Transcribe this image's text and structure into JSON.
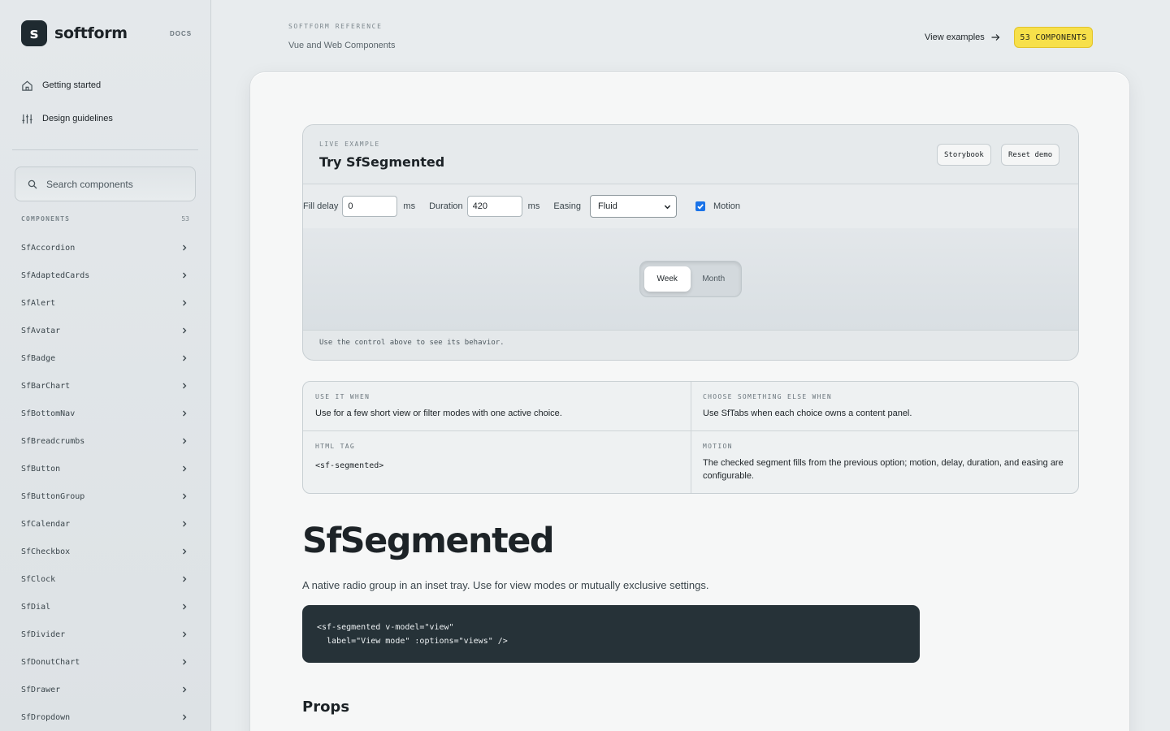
{
  "brand": {
    "name": "softform",
    "logo_letter": "s",
    "docs_label": "DOCS"
  },
  "nav": {
    "getting_started": "Getting started",
    "design_guidelines": "Design guidelines"
  },
  "search": {
    "placeholder": "Search components"
  },
  "components": {
    "heading": "COMPONENTS",
    "count": "53",
    "items": [
      "SfAccordion",
      "SfAdaptedCards",
      "SfAlert",
      "SfAvatar",
      "SfBadge",
      "SfBarChart",
      "SfBottomNav",
      "SfBreadcrumbs",
      "SfButton",
      "SfButtonGroup",
      "SfCalendar",
      "SfCheckbox",
      "SfClock",
      "SfDial",
      "SfDivider",
      "SfDonutChart",
      "SfDrawer",
      "SfDropdown"
    ]
  },
  "header": {
    "kicker": "SOFTFORM REFERENCE",
    "subtitle": "Vue and Web Components",
    "view_examples": "View examples",
    "badge": "53 COMPONENTS"
  },
  "live": {
    "kicker": "LIVE EXAMPLE",
    "title": "Try SfSegmented",
    "storybook": "Storybook",
    "reset": "Reset demo",
    "fill_delay_label": "Fill delay",
    "fill_delay_value": "0",
    "duration_label": "Duration",
    "duration_value": "420",
    "unit": "ms",
    "easing_label": "Easing",
    "easing_value": "Fluid",
    "motion_label": "Motion",
    "motion_checked": true,
    "segments": [
      "Week",
      "Month"
    ],
    "footer": "Use the control above to see its behavior."
  },
  "info": {
    "use_when_k": "USE IT WHEN",
    "use_when_v": "Use for a few short view or filter modes with one active choice.",
    "else_k": "CHOOSE SOMETHING ELSE WHEN",
    "else_v": "Use SfTabs when each choice owns a content panel.",
    "tag_k": "HTML TAG",
    "tag_v": "<sf-segmented>",
    "motion_k": "MOTION",
    "motion_v": "The checked segment fills from the previous option; motion, delay, duration, and easing are configurable."
  },
  "doc": {
    "title": "SfSegmented",
    "description": "A native radio group in an inset tray. Use for view modes or mutually exclusive settings.",
    "code": "<sf-segmented v-model=\"view\"\n  label=\"View mode\" :options=\"views\" />",
    "props_heading": "Props"
  },
  "colors": {
    "accent_badge": "#f7e04a",
    "code_bg": "#263238",
    "logo_bg": "#1f2a30"
  }
}
